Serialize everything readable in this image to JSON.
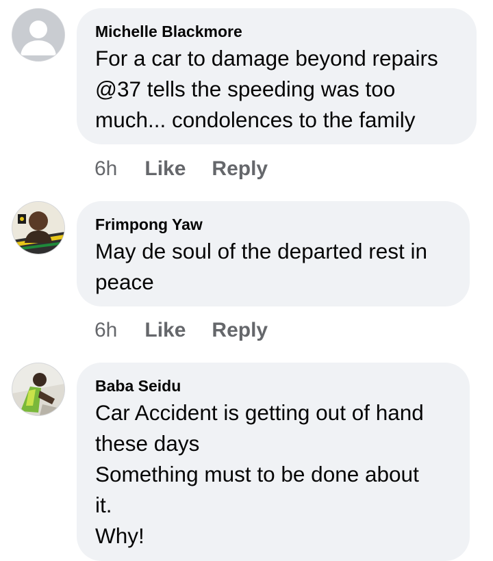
{
  "comments": [
    {
      "author": "Michelle Blackmore",
      "avatar_icon": "default-profile-icon",
      "text": "For a car to damage beyond repairs\n@37 tells the speeding was too\nmuch... condolences to the family",
      "time": "6h",
      "like_label": "Like",
      "reply_label": "Reply"
    },
    {
      "author": "Frimpong Yaw",
      "avatar_icon": "profile-photo",
      "text": "May de soul of the departed rest in\npeace",
      "time": "6h",
      "like_label": "Like",
      "reply_label": "Reply"
    },
    {
      "author": "Baba Seidu",
      "avatar_icon": "profile-photo",
      "text": "Car Accident is getting out of hand\nthese days\nSomething must to be done about\nit.\nWhy!"
    }
  ],
  "colors": {
    "bubble": "#f0f2f5",
    "text": "#050505",
    "meta": "#65676b"
  }
}
